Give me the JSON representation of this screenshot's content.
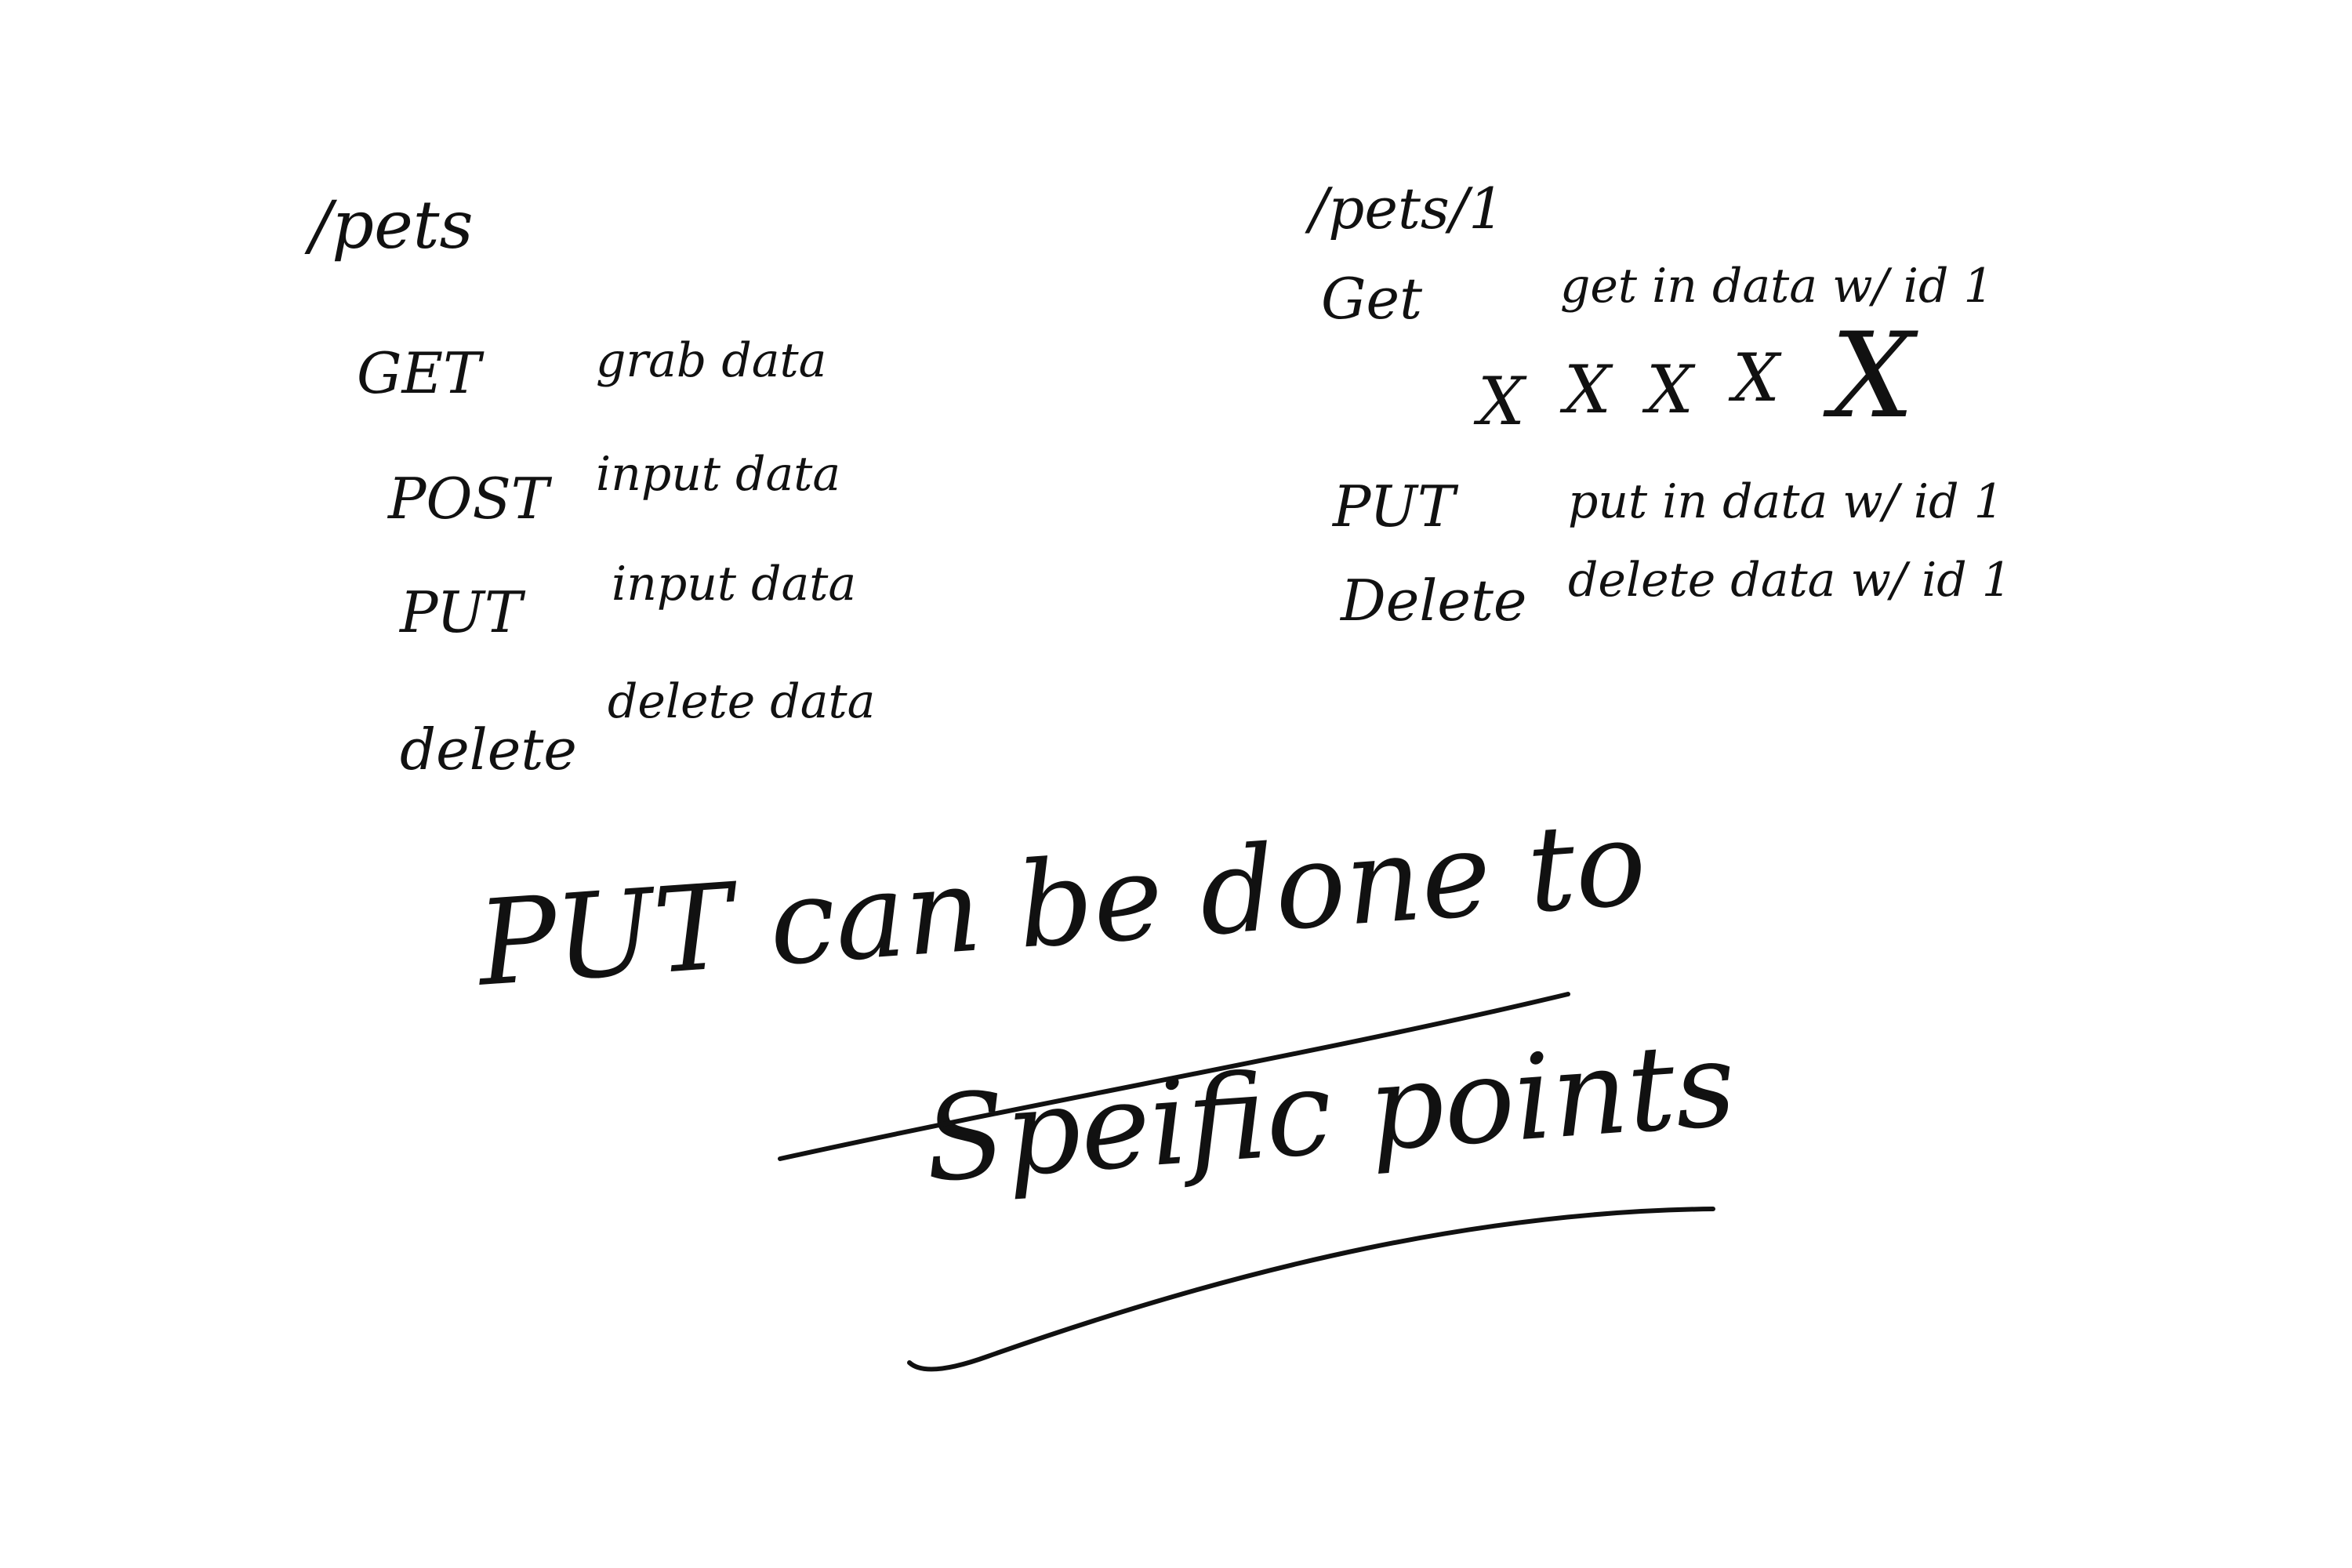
{
  "left_section": {
    "endpoint": "/pets",
    "rows": [
      {
        "method": "GET",
        "action": "grab data"
      },
      {
        "method": "POST",
        "action": "input data"
      },
      {
        "method": "PUT",
        "action": "input data"
      },
      {
        "method": "delete",
        "action": "delete data"
      }
    ]
  },
  "right_section": {
    "endpoint": "/pets/1",
    "rows": [
      {
        "method": "Get",
        "action": "get in data w/ id 1"
      },
      {
        "method": "PUT",
        "action": "put in data w/ id 1"
      },
      {
        "method": "Delete",
        "action": "delete data w/ id 1"
      }
    ],
    "marks": [
      "X",
      "X",
      "X",
      "X",
      "X"
    ]
  },
  "note": {
    "line1": "PUT can be done to",
    "line2": "Speific points"
  }
}
